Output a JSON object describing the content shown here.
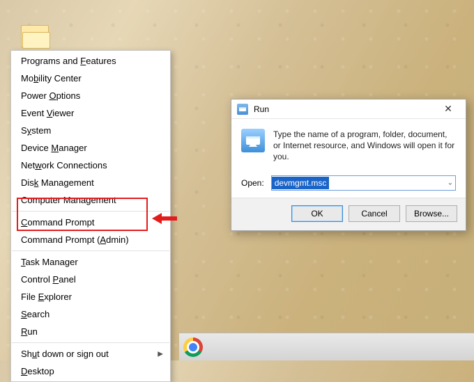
{
  "desktop": {
    "folder_icon": "folder"
  },
  "menu": {
    "items": [
      {
        "id": "programs-features",
        "pre": "Programs and ",
        "key": "F",
        "post": "eatures"
      },
      {
        "id": "mobility-center",
        "pre": "Mo",
        "key": "b",
        "post": "ility Center"
      },
      {
        "id": "power-options",
        "pre": "Power ",
        "key": "O",
        "post": "ptions"
      },
      {
        "id": "event-viewer",
        "pre": "Event ",
        "key": "V",
        "post": "iewer"
      },
      {
        "id": "system",
        "pre": "S",
        "key": "y",
        "post": "stem"
      },
      {
        "id": "device-manager",
        "pre": "Device ",
        "key": "M",
        "post": "anager"
      },
      {
        "id": "network-connections",
        "pre": "Net",
        "key": "w",
        "post": "ork Connections"
      },
      {
        "id": "disk-management",
        "pre": "Dis",
        "key": "k",
        "post": " Management"
      },
      {
        "id": "computer-management",
        "pre": "Computer Mana",
        "key": "g",
        "post": "ement"
      }
    ],
    "cmd": {
      "pre": "",
      "key": "C",
      "post": "ommand Prompt"
    },
    "cmd_admin": {
      "pre": "Command Prompt (",
      "key": "A",
      "post": "dmin)"
    },
    "items2": [
      {
        "id": "task-manager",
        "pre": "",
        "key": "T",
        "post": "ask Manager"
      },
      {
        "id": "control-panel",
        "pre": "Control ",
        "key": "P",
        "post": "anel"
      },
      {
        "id": "file-explorer",
        "pre": "File ",
        "key": "E",
        "post": "xplorer"
      },
      {
        "id": "search",
        "pre": "",
        "key": "S",
        "post": "earch"
      },
      {
        "id": "run",
        "pre": "",
        "key": "R",
        "post": "un"
      }
    ],
    "shutdown": {
      "pre": "Sh",
      "key": "u",
      "post": "t down or sign out"
    },
    "desktop": {
      "pre": "",
      "key": "D",
      "post": "esktop"
    }
  },
  "run_dialog": {
    "title": "Run",
    "description": "Type the name of a program, folder, document, or Internet resource, and Windows will open it for you.",
    "open_label": "Open:",
    "open_value": "devmgmt.msc",
    "ok": "OK",
    "cancel": "Cancel",
    "browse": "Browse..."
  },
  "taskbar": {
    "chrome": "chrome"
  }
}
